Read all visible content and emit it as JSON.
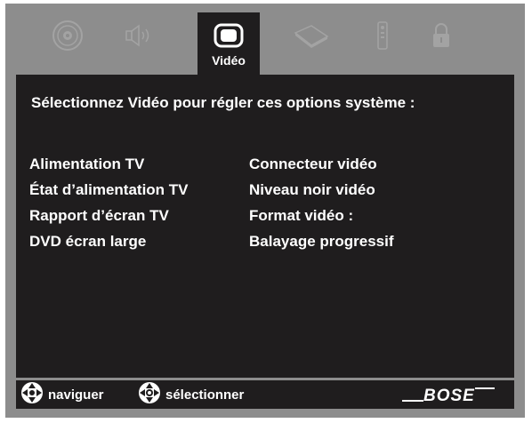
{
  "menu": {
    "active_tab": "Vidéo",
    "tabs": [
      {
        "icon": "disc-icon"
      },
      {
        "icon": "speaker-icon"
      },
      {
        "icon": "tv-screen-icon"
      },
      {
        "icon": "remote-sensor-icon"
      },
      {
        "icon": "remote-control-icon"
      },
      {
        "icon": "lock-icon"
      }
    ]
  },
  "panel": {
    "intro": "Sélectionnez Vidéo pour régler ces options système :",
    "options_left": [
      "Alimentation TV",
      "État d’alimentation TV",
      "Rapport d’écran TV",
      "DVD écran large"
    ],
    "options_right": [
      "Connecteur vidéo",
      "Niveau noir vidéo",
      "Format vidéo :",
      "Balayage progressif"
    ]
  },
  "footer": {
    "navigate_label": "naviguer",
    "select_label": "sélectionner",
    "brand": "BOSE"
  },
  "colors": {
    "background": "#8d8d8d",
    "panel": "#1f1d1e",
    "text": "#ffffff",
    "inactive_icon": "#a3a3a3"
  }
}
